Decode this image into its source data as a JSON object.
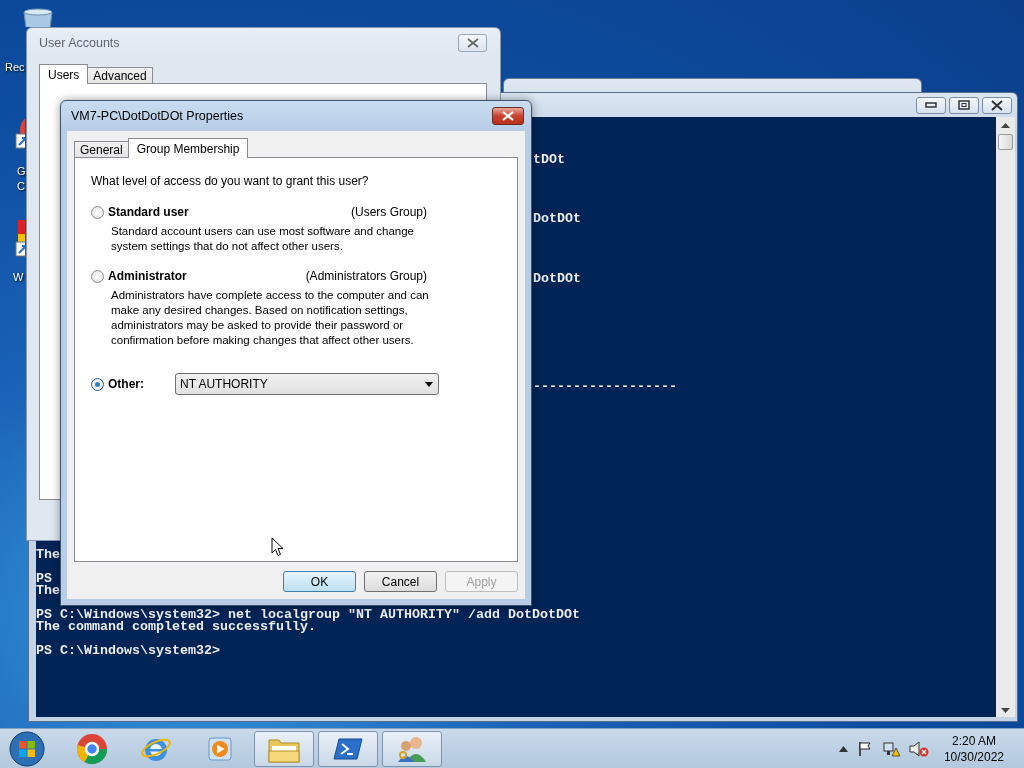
{
  "desktop": {
    "icons": [
      {
        "kind": "recycle_bin",
        "label_lines": [
          "Rec"
        ]
      },
      {
        "kind": "browser_shortcut",
        "label_lines": [
          "G",
          "C"
        ]
      },
      {
        "kind": "app_shortcut",
        "label_lines": [
          "W"
        ]
      }
    ]
  },
  "console": {
    "visible_fragments": [
      "tDOt",
      "DotDOt",
      "DotDOt",
      "------------------"
    ],
    "blocks": [
      [
        "The"
      ],
      [
        "PS",
        "The"
      ],
      [
        "PS C:\\Windows\\system32> net localgroup \"NT AUTHORITY\" /add DotDotDOt",
        "The command completed successfully."
      ],
      [
        "PS C:\\Windows\\system32>"
      ]
    ]
  },
  "user_accounts": {
    "title": "User Accounts",
    "tabs": [
      {
        "label": "Users",
        "selected": true
      },
      {
        "label": "Advanced",
        "selected": false
      }
    ]
  },
  "dialog": {
    "title": "VM7-PC\\DotDotDOt Properties",
    "tabs": [
      {
        "label": "General",
        "selected": false
      },
      {
        "label": "Group Membership",
        "selected": true
      }
    ],
    "question": "What level of access do you want to grant this user?",
    "options": [
      {
        "kind": "described",
        "label": "Standard user",
        "group": "(Users Group)",
        "description": "Standard account users can use most software and change system settings that do not affect other users.",
        "selected": false
      },
      {
        "kind": "described",
        "label": "Administrator",
        "group": "(Administrators Group)",
        "description": "Administrators have complete access to the computer and can make any desired changes. Based on notification settings, administrators may be asked to provide their password or confirmation before making changes that affect other users.",
        "selected": false
      },
      {
        "kind": "dropdown",
        "label": "Other:",
        "value": "NT AUTHORITY",
        "selected": true
      }
    ],
    "buttons": [
      {
        "label": "OK",
        "default": true,
        "disabled": false
      },
      {
        "label": "Cancel",
        "default": false,
        "disabled": false
      },
      {
        "label": "Apply",
        "default": false,
        "disabled": true
      }
    ]
  },
  "taskbar": {
    "items": [
      {
        "kind": "browser",
        "running": false
      },
      {
        "kind": "globe",
        "running": false
      },
      {
        "kind": "player",
        "running": false
      },
      {
        "kind": "folder",
        "running": true
      },
      {
        "kind": "terminal",
        "running": true
      },
      {
        "kind": "users",
        "running": true
      }
    ],
    "time": "2:20 AM",
    "date": "10/30/2022"
  }
}
